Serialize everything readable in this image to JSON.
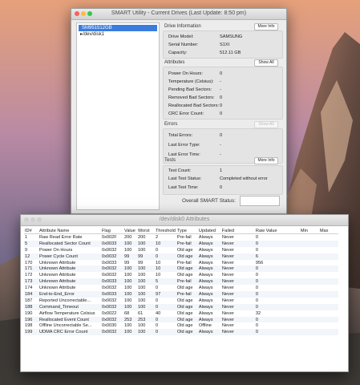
{
  "smart_window": {
    "title": "SMART Utility - Current Drives (Last Update: 8:50 pm)",
    "drives": [
      {
        "label": "SM951512GB",
        "selected": true
      },
      {
        "label": "/dev/disk1",
        "selected": false
      }
    ],
    "drive_info": {
      "header": "Drive Information",
      "more_info": "More Info",
      "rows": [
        {
          "label": "Drive Model:",
          "value": "SAMSUNG"
        },
        {
          "label": "Serial Number:",
          "value": "S1XI"
        },
        {
          "label": "Capacity:",
          "value": "512.11 GB"
        }
      ]
    },
    "attributes": {
      "header": "Attributes",
      "show_all": "Show All",
      "rows": [
        {
          "label": "Power On Hours:",
          "value": "0"
        },
        {
          "label": "Temperature (Celsius):",
          "value": "-"
        },
        {
          "label": "Pending Bad Sectors:",
          "value": "-"
        },
        {
          "label": "Removed Bad Sectors:",
          "value": "0"
        },
        {
          "label": "Reallocated Bad Sectors:",
          "value": "0"
        },
        {
          "label": "CRC Error Count:",
          "value": "0"
        }
      ]
    },
    "errors": {
      "header": "Errors",
      "show_all": "Show All",
      "rows": [
        {
          "label": "Total Errors:",
          "value": "0"
        },
        {
          "label": "Last Error Type:",
          "value": "-"
        },
        {
          "label": "Last Error Time:",
          "value": "-"
        }
      ]
    },
    "tests": {
      "header": "Tests",
      "more_info": "More Info",
      "rows": [
        {
          "label": "Test Count:",
          "value": "1"
        },
        {
          "label": "Last Test Status:",
          "value": "Completed without error"
        },
        {
          "label": "Last Test Time:",
          "value": "0"
        }
      ]
    },
    "overall_label": "Overall SMART Status:",
    "overall_value": ""
  },
  "attr_window": {
    "title": "/dev/disk0 Attributes",
    "columns": [
      "ID#",
      "Attribute Name",
      "Flag",
      "Value",
      "Worst",
      "Threshold",
      "Type",
      "Updated",
      "Failed",
      "Raw Value",
      "Min",
      "Max"
    ],
    "rows": [
      [
        "1",
        "Raw Read Error Rate",
        "0x002F",
        "200",
        "200",
        "2",
        "Pre-fail",
        "Always",
        "Never",
        "0",
        "",
        ""
      ],
      [
        "5",
        "Reallocated Sector Count",
        "0x0033",
        "100",
        "100",
        "10",
        "Pre-fail",
        "Always",
        "Never",
        "0",
        "",
        ""
      ],
      [
        "9",
        "Power On Hours",
        "0x0032",
        "100",
        "100",
        "0",
        "Old age",
        "Always",
        "Never",
        "0",
        "",
        ""
      ],
      [
        "12",
        "Power Cycle Count",
        "0x0032",
        "99",
        "99",
        "0",
        "Old age",
        "Always",
        "Never",
        "6",
        "",
        ""
      ],
      [
        "170",
        "Unknown Attribute",
        "0x0033",
        "99",
        "99",
        "10",
        "Pre-fail",
        "Always",
        "Never",
        "956",
        "",
        ""
      ],
      [
        "171",
        "Unknown Attribute",
        "0x0032",
        "100",
        "100",
        "10",
        "Old age",
        "Always",
        "Never",
        "0",
        "",
        ""
      ],
      [
        "172",
        "Unknown Attribute",
        "0x0032",
        "100",
        "100",
        "10",
        "Old age",
        "Always",
        "Never",
        "0",
        "",
        ""
      ],
      [
        "173",
        "Unknown Attribute",
        "0x0033",
        "100",
        "100",
        "5",
        "Pre-fail",
        "Always",
        "Never",
        "0",
        "",
        ""
      ],
      [
        "174",
        "Unknown Attribute",
        "0x0032",
        "100",
        "100",
        "0",
        "Old age",
        "Always",
        "Never",
        "0",
        "",
        ""
      ],
      [
        "184",
        "End-to-End_Error",
        "0x0033",
        "100",
        "100",
        "97",
        "Pre-fail",
        "Always",
        "Never",
        "0",
        "",
        ""
      ],
      [
        "187",
        "Reported Uncorrectable...",
        "0x0032",
        "100",
        "100",
        "0",
        "Old age",
        "Always",
        "Never",
        "0",
        "",
        ""
      ],
      [
        "188",
        "Command_Timeout",
        "0x0032",
        "100",
        "100",
        "0",
        "Old age",
        "Always",
        "Never",
        "0",
        "",
        ""
      ],
      [
        "190",
        "Airflow Temperature Celsius",
        "0x0022",
        "68",
        "61",
        "40",
        "Old age",
        "Always",
        "Never",
        "32",
        "",
        ""
      ],
      [
        "196",
        "Reallocated Event Count",
        "0x0032",
        "253",
        "253",
        "0",
        "Old age",
        "Always",
        "Never",
        "0",
        "",
        ""
      ],
      [
        "198",
        "Offline Uncorrectable Se...",
        "0x0030",
        "100",
        "100",
        "0",
        "Old age",
        "Offline",
        "Never",
        "0",
        "",
        ""
      ],
      [
        "199",
        "UDMA CRC Error Count",
        "0x0032",
        "100",
        "100",
        "0",
        "Old age",
        "Always",
        "Never",
        "0",
        "",
        ""
      ]
    ]
  },
  "colors": {
    "selection": "#3b7ddd",
    "close": "#fc605c",
    "minimize": "#fdbc40",
    "zoom": "#34c84a"
  }
}
